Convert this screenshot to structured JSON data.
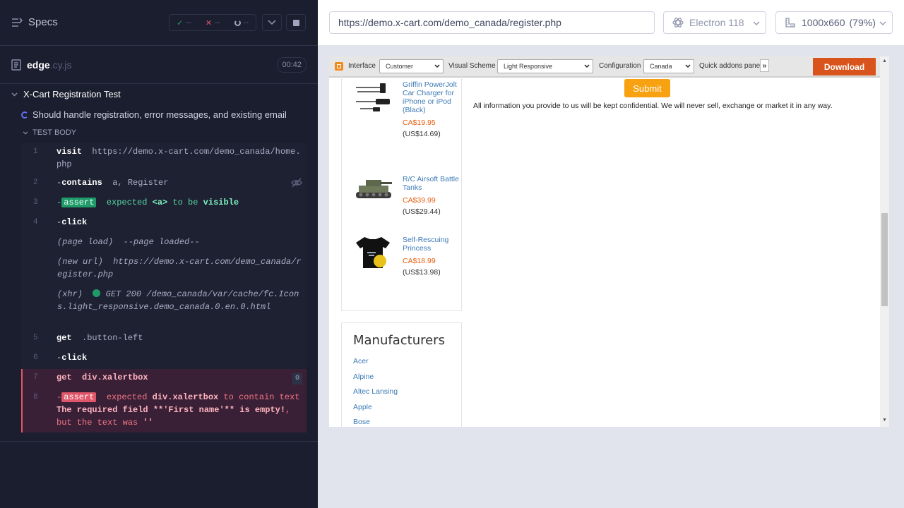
{
  "reporter": {
    "title": "Specs",
    "stats": {
      "passed": "--",
      "failed": "--",
      "pending": "--"
    },
    "spec_file": {
      "name": "edge",
      "ext": ".cy.js",
      "duration": "00:42"
    },
    "suite_title": "X-Cart Registration Test",
    "test_title": "Should handle registration, error messages, and existing email",
    "test_body_label": "TEST BODY",
    "commands": {
      "c1": {
        "num": "1",
        "name": "visit",
        "arg": "https://demo.x-cart.com/demo_canada/home.php"
      },
      "c2": {
        "num": "2",
        "prefix": "-",
        "name": "contains",
        "arg": "a, Register"
      },
      "c3": {
        "num": "3",
        "prefix": "-",
        "badge": "assert",
        "w1": "expected",
        "w2": "<a>",
        "w3": "to be",
        "w4": "visible"
      },
      "c4": {
        "num": "4",
        "prefix": "-",
        "name": "click"
      },
      "ev1": {
        "label": "(page load)",
        "text": "--page loaded--"
      },
      "ev2": {
        "label": "(new url)",
        "text": "https://demo.x-cart.com/demo_canada/register.php"
      },
      "ev3": {
        "label": "(xhr)",
        "status": "GET 200",
        "text": "/demo_canada/var/cache/fc.Icons.light_responsive.demo_canada.0.en.0.html"
      },
      "c5": {
        "num": "5",
        "name": "get",
        "arg": ".button-left"
      },
      "c6": {
        "num": "6",
        "prefix": "-",
        "name": "click"
      },
      "c7": {
        "num": "7",
        "name": "get",
        "arg": "div.xalertbox",
        "count": "0"
      },
      "c8": {
        "num": "8",
        "prefix": "-",
        "badge": "assert",
        "w1": "expected",
        "w2": "div.xalertbox",
        "w3": "to contain text",
        "w4": "The required field **'First name'** is empty!",
        "w5": ", but the text was",
        "w6": "''"
      }
    }
  },
  "preview": {
    "url": "https://demo.x-cart.com/demo_canada/register.php",
    "browser": "Electron 118",
    "viewport": "1000x660",
    "zoom": "(79%)"
  },
  "aut": {
    "toolbar": {
      "interface_label": "Interface",
      "interface_value": "Customer",
      "scheme_label": "Visual Scheme",
      "scheme_value": "Light Responsive",
      "config_label": "Configuration",
      "config_value": "Canada",
      "addons_label": "Quick addons panel",
      "download_label": "Download"
    },
    "products": [
      {
        "name": "Griffin PowerJolt Car Charger for iPhone or iPod (Black)",
        "price": "CA$19.95",
        "usd": "(US$14.69)"
      },
      {
        "name": "R/C Airsoft Battle Tanks",
        "price": "CA$39.99",
        "usd": "(US$29.44)"
      },
      {
        "name": "Self-Rescuing Princess",
        "price": "CA$18.99",
        "usd": "(US$13.98)"
      }
    ],
    "manufacturers": {
      "title": "Manufacturers",
      "items": [
        "Acer",
        "Alpine",
        "Altec Lansing",
        "Apple",
        "Bose"
      ]
    },
    "submit_label": "Submit",
    "info_text": "All information you provide to us will be kept confidential. We will never sell, exchange or market it in any way."
  },
  "colors": {
    "reporter_bg": "#1b1e2e",
    "pass_green": "#1f9b6a",
    "fail_red": "#e0576a",
    "link_blue": "#3d7bb6",
    "price_orange": "#e85f12",
    "submit_orange": "#f8a111",
    "download_orange": "#d9541c"
  },
  "icons": {
    "specs": "list-icon",
    "file": "document-icon",
    "eye": "eye-slash-icon",
    "browser": "electron-icon",
    "viewport": "ruler-icon"
  }
}
